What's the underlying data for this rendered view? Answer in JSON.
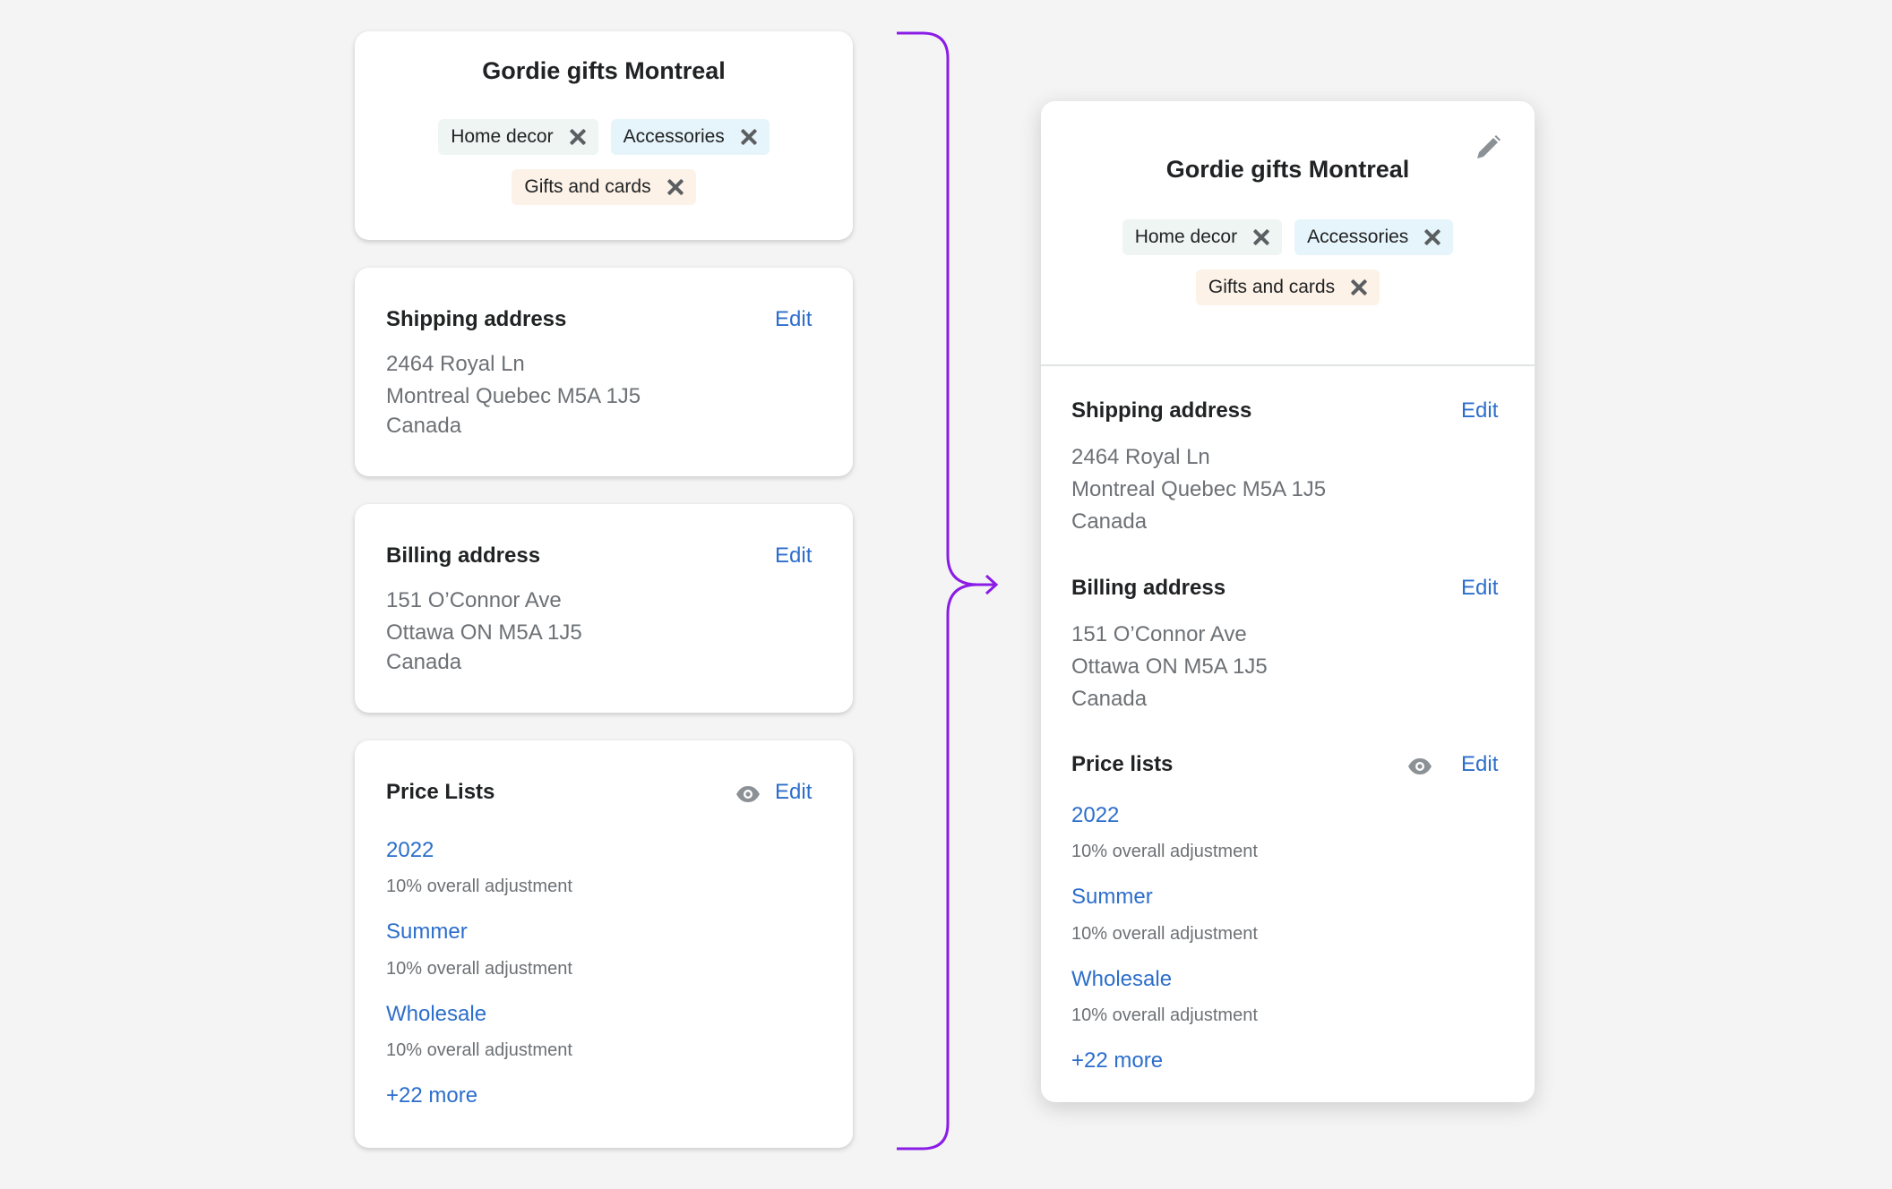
{
  "colors": {
    "accent": "#8a1ce6",
    "link": "#2c6ecb",
    "tag_home": "#eef5f3",
    "tag_acc": "#e6f5fb",
    "tag_gifts": "#fdf2e8"
  },
  "company": "Gordie gifts Montreal",
  "tags": [
    {
      "label": "Home decor",
      "icon": "close-icon"
    },
    {
      "label": "Accessories",
      "icon": "close-icon"
    },
    {
      "label": "Gifts and cards",
      "icon": "close-icon"
    }
  ],
  "shipping": {
    "heading": "Shipping address",
    "edit": "Edit",
    "lines": [
      "2464 Royal Ln",
      "Montreal Quebec M5A 1J5",
      "Canada"
    ]
  },
  "billing": {
    "heading": "Billing address",
    "edit": "Edit",
    "lines": [
      "151 O’Connor Ave",
      "Ottawa ON M5A 1J5",
      "Canada"
    ]
  },
  "price_lists": {
    "heading_left": "Price Lists",
    "heading_right": "Price lists",
    "edit": "Edit",
    "icon": "eye-icon",
    "items": [
      {
        "name": "2022",
        "note": "10% overall adjustment"
      },
      {
        "name": "Summer",
        "note": "10% overall adjustment"
      },
      {
        "name": "Wholesale",
        "note": "10% overall adjustment"
      }
    ],
    "more": "+22 more"
  },
  "edit_icon": "pencil-icon"
}
